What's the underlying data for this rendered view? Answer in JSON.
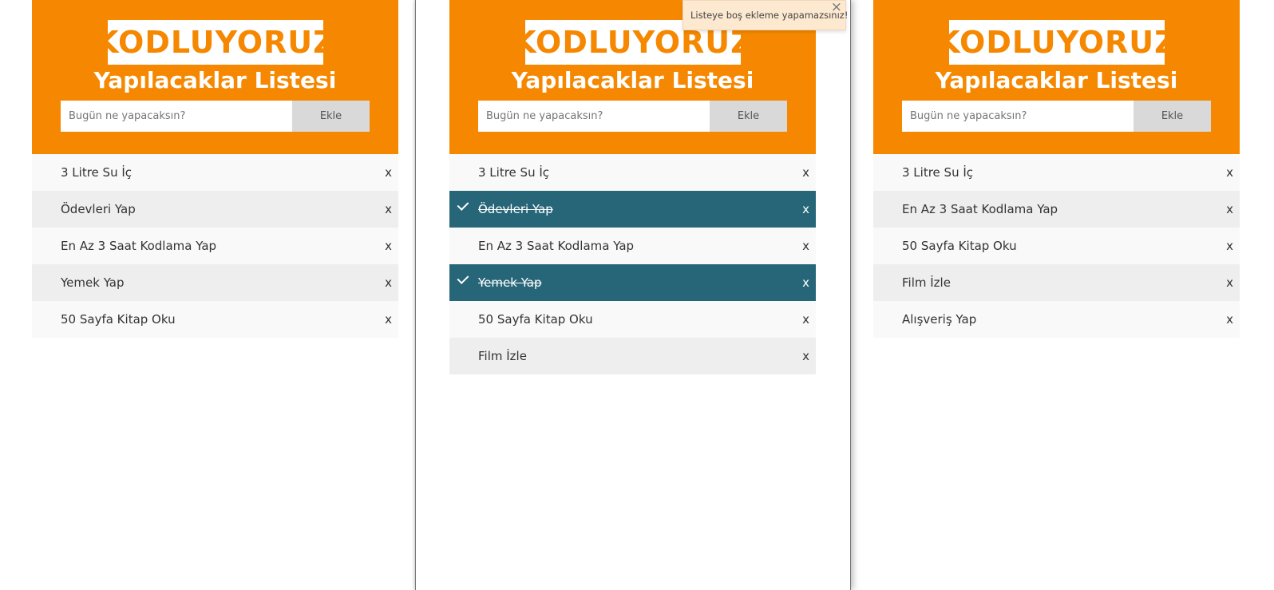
{
  "panels": [
    {
      "logo": "KODLUYORUZ",
      "title": "Yapılacaklar Listesi",
      "input_placeholder": "Bugün ne yapacaksın?",
      "add_label": "Ekle",
      "items": [
        {
          "label": "3 Litre Su İç",
          "close": "x",
          "checked": false
        },
        {
          "label": "Ödevleri Yap",
          "close": "x",
          "checked": false
        },
        {
          "label": "En Az 3 Saat Kodlama Yap",
          "close": "x",
          "checked": false
        },
        {
          "label": "Yemek Yap",
          "close": "x",
          "checked": false
        },
        {
          "label": "50 Sayfa Kitap Oku",
          "close": "x",
          "checked": false
        }
      ]
    },
    {
      "logo": "KODLUYORUZ",
      "title": "Yapılacaklar Listesi",
      "input_placeholder": "Bugün ne yapacaksın?",
      "add_label": "Ekle",
      "items": [
        {
          "label": "3 Litre Su İç",
          "close": "x",
          "checked": false
        },
        {
          "label": "Ödevleri Yap",
          "close": "x",
          "checked": true
        },
        {
          "label": "En Az 3 Saat Kodlama Yap",
          "close": "x",
          "checked": false
        },
        {
          "label": "Yemek Yap",
          "close": "x",
          "checked": true
        },
        {
          "label": "50 Sayfa Kitap Oku",
          "close": "x",
          "checked": false
        },
        {
          "label": "Film İzle",
          "close": "x",
          "checked": false
        }
      ]
    },
    {
      "logo": "KODLUYORUZ",
      "title": "Yapılacaklar Listesi",
      "input_placeholder": "Bugün ne yapacaksın?",
      "add_label": "Ekle",
      "items": [
        {
          "label": "3 Litre Su İç",
          "close": "x",
          "checked": false
        },
        {
          "label": "En Az 3 Saat Kodlama Yap",
          "close": "x",
          "checked": false
        },
        {
          "label": "50 Sayfa Kitap Oku",
          "close": "x",
          "checked": false
        },
        {
          "label": "Film İzle",
          "close": "x",
          "checked": false
        },
        {
          "label": "Alışveriş Yap",
          "close": "x",
          "checked": false
        }
      ]
    }
  ],
  "toast": {
    "message": "Listeye boş ekleme yapamazsınız!",
    "close": "×"
  },
  "colors": {
    "brand_orange": "#f58800",
    "checked_bg": "#276678",
    "button_gray": "#d9d9d9",
    "toast_bg": "#fde8d0"
  }
}
